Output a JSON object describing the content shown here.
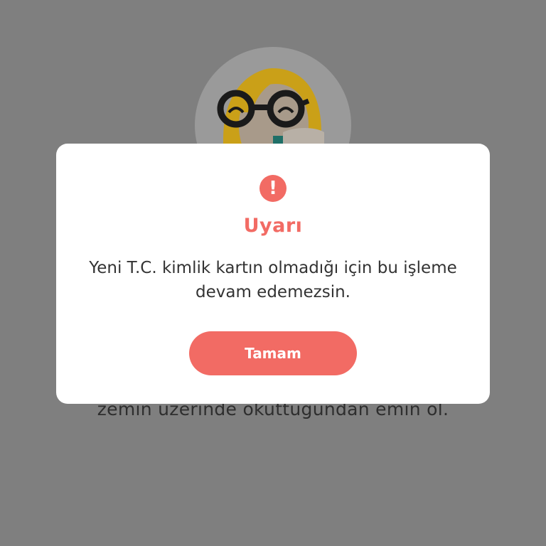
{
  "background": {
    "avatar_icon": "nerd-girl-avatar",
    "instruction_line_1": "",
    "instruction_line_2": "zemin üzerinde okuttuğundan emin ol."
  },
  "dialog": {
    "icon": "exclamation-icon",
    "icon_glyph": "!",
    "title": "Uyarı",
    "message": "Yeni T.C. kimlik kartın olmadığı için bu işleme devam edemezsin.",
    "confirm_label": "Tamam"
  },
  "colors": {
    "overlay": "#7f7f7f",
    "accent": "#f26b64",
    "dialog_bg": "#ffffff",
    "text": "#333333"
  }
}
